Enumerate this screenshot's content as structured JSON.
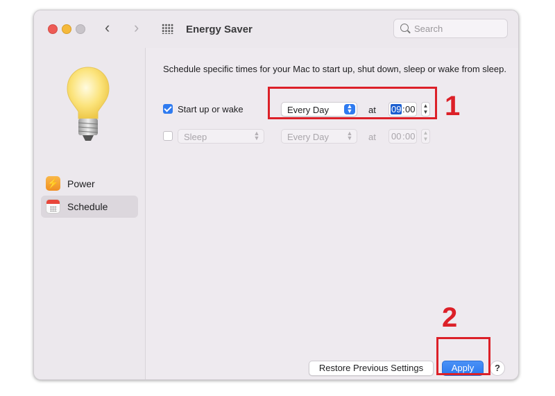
{
  "window": {
    "title": "Energy Saver",
    "nav_back": "‹",
    "nav_forward": "›"
  },
  "search": {
    "placeholder": "Search"
  },
  "sidebar": {
    "items": [
      {
        "label": "Power",
        "icon": "bolt-icon",
        "selected": false
      },
      {
        "label": "Schedule",
        "icon": "calendar-icon",
        "selected": true
      }
    ]
  },
  "schedule": {
    "description": "Schedule specific times for your Mac to start up, shut down, sleep or wake from sleep.",
    "rows": [
      {
        "enabled": true,
        "label": "Start up or wake",
        "frequency": "Every Day",
        "at": "at",
        "hour": "09",
        "minute": "00"
      },
      {
        "enabled": false,
        "label": "Sleep",
        "frequency": "Every Day",
        "at": "at",
        "hour": "00",
        "minute": "00"
      }
    ]
  },
  "footer": {
    "restore_label": "Restore Previous Settings",
    "apply_label": "Apply",
    "help_label": "?"
  },
  "annotations": {
    "step1": "1",
    "step2": "2",
    "color": "#dc2028"
  },
  "colors": {
    "accent": "#2f7bf0",
    "window_bg": "#eeeaef"
  }
}
